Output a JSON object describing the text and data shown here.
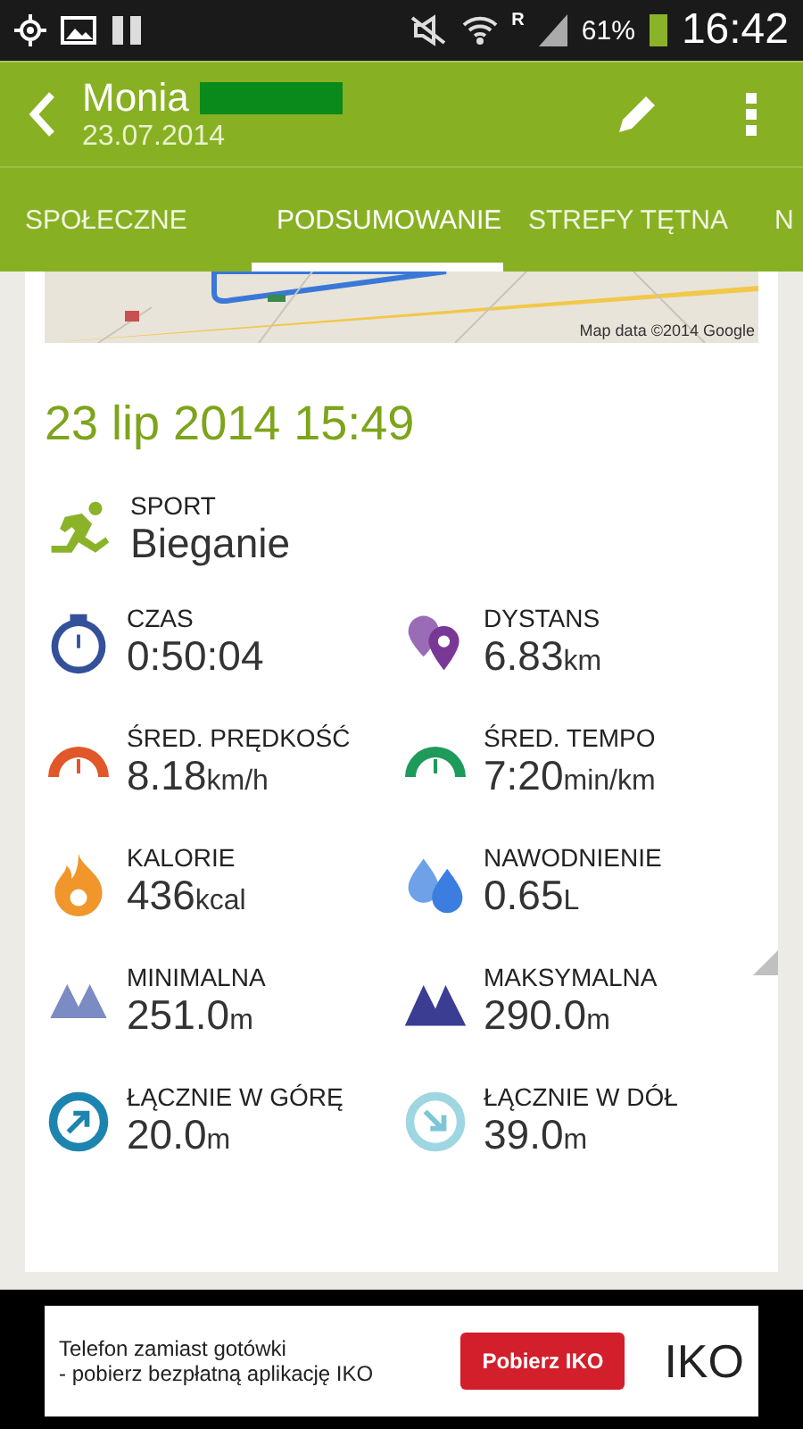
{
  "status_bar": {
    "battery": "61%",
    "time": "16:42",
    "network": "R"
  },
  "header": {
    "title": "Monia",
    "subtitle": "23.07.2014"
  },
  "tabs": [
    {
      "label": "SPOŁECZNE",
      "selected": false
    },
    {
      "label": "PODSUMOWANIE",
      "selected": true
    },
    {
      "label": "STREFY TĘTNA",
      "selected": false
    },
    {
      "label": "N",
      "selected": false
    }
  ],
  "map": {
    "kind": "picture",
    "attribution": "Map data ©2014 Google"
  },
  "workout": {
    "datetime": "23 lip 2014 15:49",
    "sport_label": "SPORT",
    "sport": "Bieganie"
  },
  "metrics": [
    {
      "kind": "stopwatch",
      "label": "CZAS",
      "value": "0:50:04"
    },
    {
      "kind": "pins",
      "label": "DYSTANS",
      "value": "6.83",
      "unit": "km"
    },
    {
      "kind": "speed",
      "label": "ŚRED. PRĘDKOŚĆ",
      "value": "8.18",
      "unit": "km/h"
    },
    {
      "kind": "pace",
      "label": "ŚRED. TEMPO",
      "value": "7:20",
      "unit": "min/km"
    },
    {
      "kind": "flame",
      "label": "KALORIE",
      "value": "436",
      "unit": "kcal"
    },
    {
      "kind": "drops",
      "label": "NAWODNIENIE",
      "value": "0.65",
      "unit": "L"
    },
    {
      "kind": "mountain-low",
      "label": "MINIMALNA",
      "value": "251.0",
      "unit": "m"
    },
    {
      "kind": "mountain-high",
      "label": "MAKSYMALNA",
      "value": "290.0",
      "unit": "m"
    },
    {
      "kind": "up",
      "label": "ŁĄCZNIE W GÓRĘ",
      "value": "20.0",
      "unit": "m"
    },
    {
      "kind": "down",
      "label": "ŁĄCZNIE W DÓŁ",
      "value": "39.0",
      "unit": "m"
    }
  ],
  "ad": {
    "text_line_1": "Telefon zamiast gotówki",
    "text_line_2": "- pobierz bezpłatną aplikację IKO",
    "button": "Pobierz IKO",
    "logo": "IKO"
  }
}
